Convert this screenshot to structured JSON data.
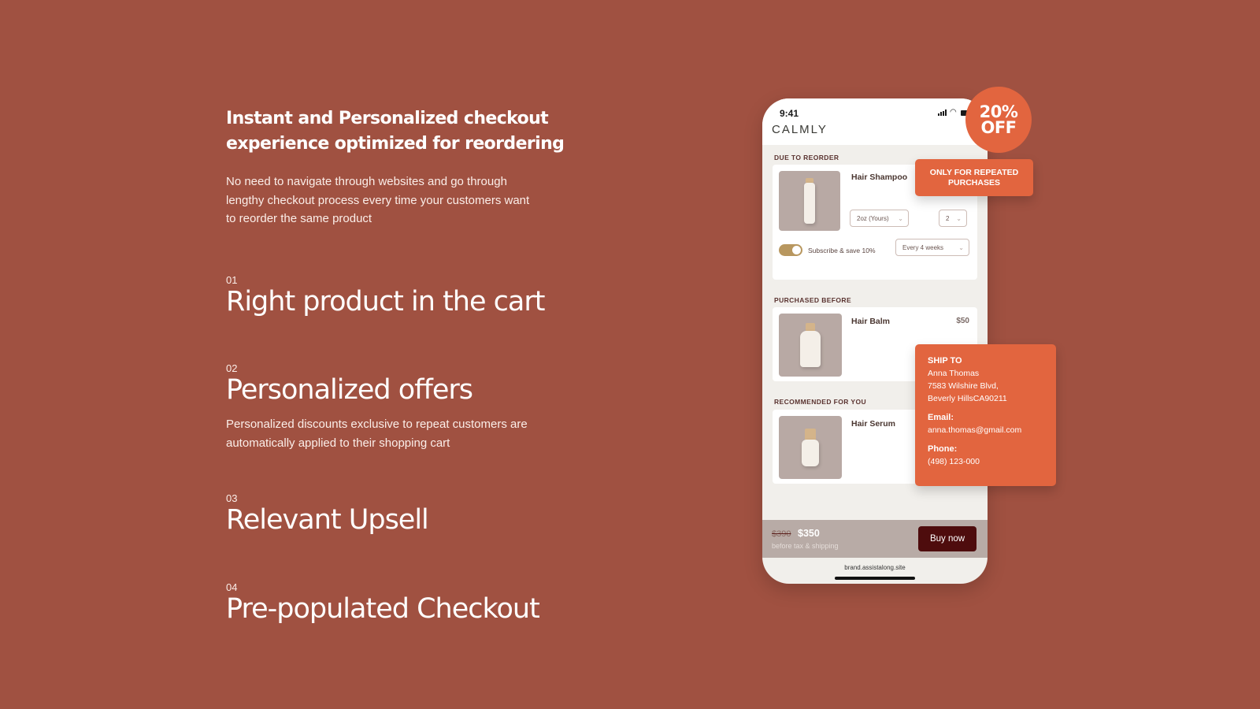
{
  "colors": {
    "background": "#A05141",
    "accent": "#E2653F",
    "buy_button": "#4E0C0D",
    "toggle_on": "#B8975F"
  },
  "intro": {
    "headline_line1": "Instant and Personalized checkout",
    "headline_line2": "experience optimized for reordering",
    "body_line1": "No need to navigate through websites and go through",
    "body_line2": "lengthy checkout process every time your customers want",
    "body_line3": "to reorder the same product"
  },
  "features": [
    {
      "number": "01",
      "title": "Right product in the cart"
    },
    {
      "number": "02",
      "title": "Personalized offers",
      "desc_line1": "Personalized discounts exclusive to repeat customers are",
      "desc_line2": "automatically applied to their shopping cart"
    },
    {
      "number": "03",
      "title": "Relevant Upsell"
    },
    {
      "number": "04",
      "title": "Pre-populated Checkout"
    }
  ],
  "phone": {
    "time": "9:41",
    "wifi_icon": "wifi-icon",
    "brand": "CALMLY",
    "sections": {
      "reorder": {
        "label": "DUE TO REORDER",
        "product": "Hair Shampoo",
        "size_select": "2oz (Yours)",
        "qty_select": "2",
        "subscribe_label": "Subscribe & save 10%",
        "subscribe_on": true,
        "frequency_select": "Every 4 weeks"
      },
      "purchased": {
        "label": "PURCHASED BEFORE",
        "product": "Hair Balm",
        "price": "$50"
      },
      "recommended": {
        "label": "RECOMMENDED FOR YOU",
        "product": "Hair Serum"
      }
    },
    "footer": {
      "old_price": "$390",
      "new_price": "$350",
      "note": "before tax & shipping",
      "buy_label": "Buy now"
    },
    "url": "brand.assistalong.site"
  },
  "badge": {
    "line1": "20%",
    "line2": "OFF"
  },
  "repeat_tag": {
    "line1": "ONLY FOR REPEATED",
    "line2": "PURCHASES"
  },
  "ship_to": {
    "heading": "SHIP TO",
    "name": "Anna Thomas",
    "address1": "7583 Wilshire Blvd,",
    "address2": "Beverly HillsCA90211",
    "email_label": "Email:",
    "email": "anna.thomas@gmail.com",
    "phone_label": "Phone:",
    "phone": "(498) 123-000"
  }
}
